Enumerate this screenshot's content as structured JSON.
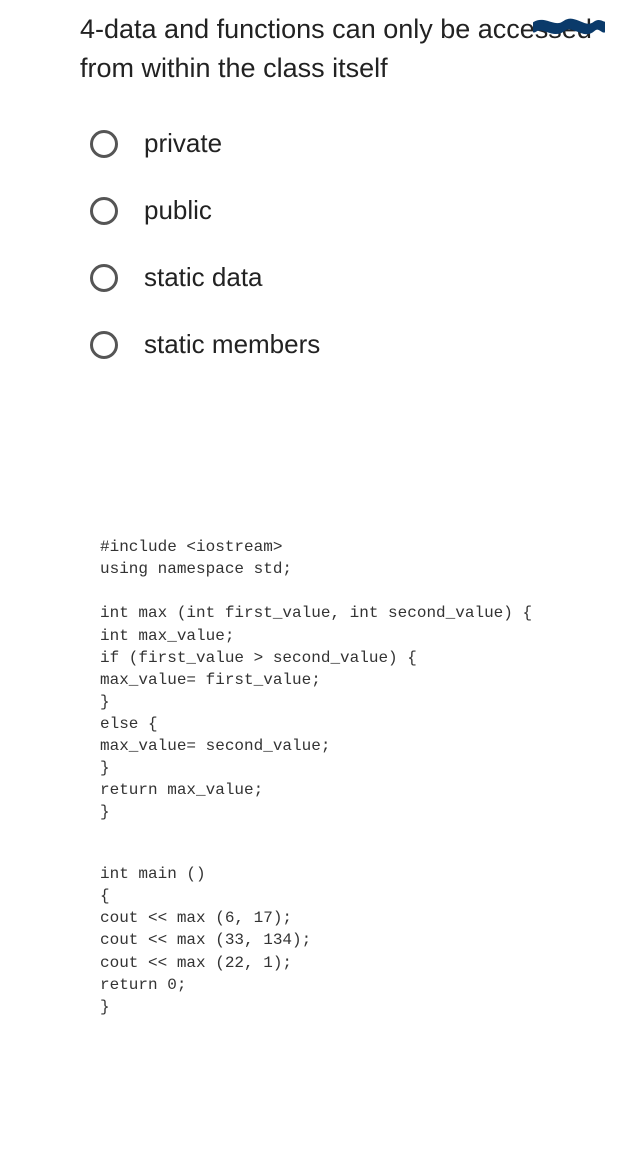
{
  "question": {
    "text": "4-data and functions can only be accessed from within the class itself"
  },
  "options": [
    {
      "label": "private"
    },
    {
      "label": "public"
    },
    {
      "label": "static data"
    },
    {
      "label": "static members"
    }
  ],
  "code": {
    "block1": "#include <iostream>\nusing namespace std;",
    "block2": "int max (int first_value, int second_value) {\nint max_value;\nif (first_value > second_value) {\nmax_value= first_value;\n}\nelse {\nmax_value= second_value;\n}\nreturn max_value;\n}",
    "block3": "int main ()\n{\ncout << max (6, 17);\ncout << max (33, 134);\ncout << max (22, 1);\nreturn 0;\n}"
  }
}
